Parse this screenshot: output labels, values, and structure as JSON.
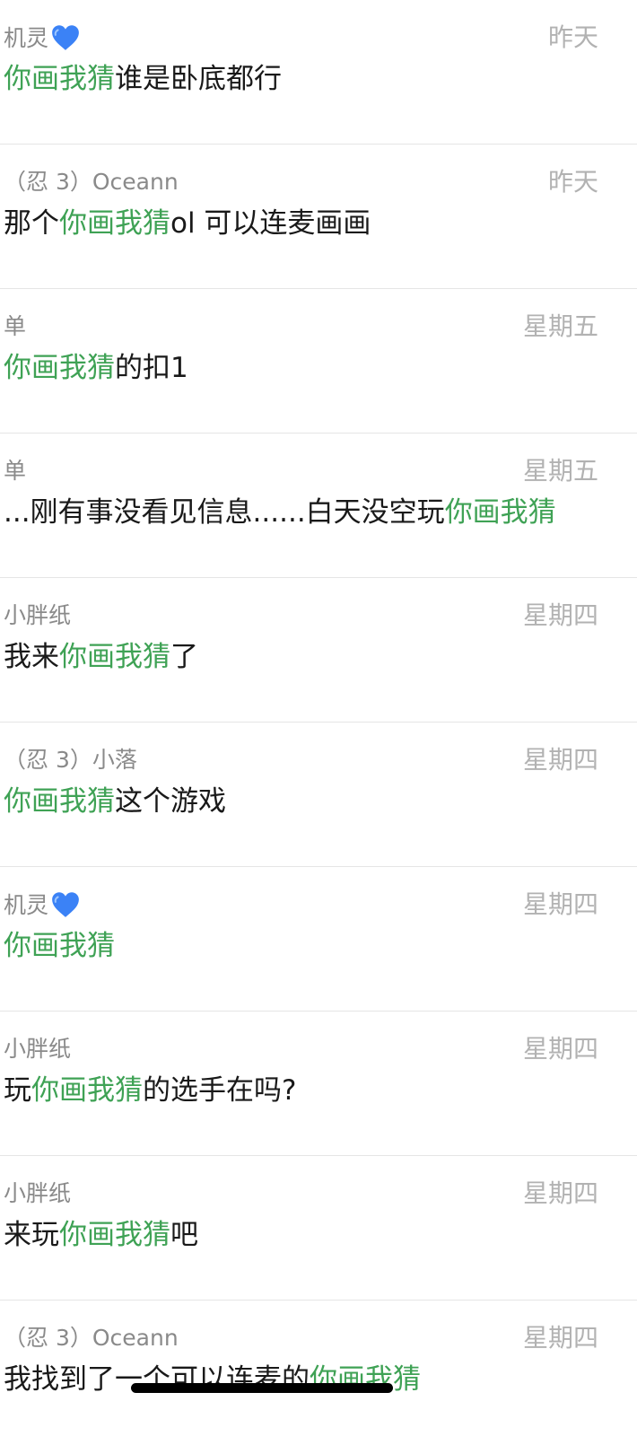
{
  "colors": {
    "highlight": "#3fa255",
    "sender": "#8a8a8a",
    "time": "#b2b2b2",
    "text": "#191919",
    "divider": "#e5e5e5"
  },
  "results": [
    {
      "sender": "机灵",
      "sender_emoji": "blue-heart-icon",
      "time": "昨天",
      "pre": "",
      "keyword": "你画我猜",
      "post": "谁是卧底都行"
    },
    {
      "sender": "（忍 3）Oceann",
      "time": "昨天",
      "pre": "那个",
      "keyword": "你画我猜",
      "post": "ol 可以连麦画画"
    },
    {
      "sender": "单",
      "time": "星期五",
      "pre": "",
      "keyword": "你画我猜",
      "post": "的扣1"
    },
    {
      "sender": "单",
      "time": "星期五",
      "pre": "...刚有事没看见信息......白天没空玩",
      "keyword": "你画我猜",
      "post": ""
    },
    {
      "sender": "小胖纸",
      "time": "星期四",
      "pre": "我来",
      "keyword": "你画我猜",
      "post": "了"
    },
    {
      "sender": "（忍 3）小落",
      "time": "星期四",
      "pre": "",
      "keyword": "你画我猜",
      "post": "这个游戏"
    },
    {
      "sender": "机灵",
      "sender_emoji": "blue-heart-icon",
      "time": "星期四",
      "pre": "",
      "keyword": "你画我猜",
      "post": ""
    },
    {
      "sender": "小胖纸",
      "time": "星期四",
      "pre": "玩",
      "keyword": "你画我猜",
      "post": "的选手在吗?"
    },
    {
      "sender": "小胖纸",
      "time": "星期四",
      "pre": "来玩",
      "keyword": "你画我猜",
      "post": "吧"
    },
    {
      "sender": "（忍 3）Oceann",
      "time": "星期四",
      "pre": "我找到了一个可以连麦的",
      "keyword": "你画我猜",
      "post": ""
    }
  ]
}
